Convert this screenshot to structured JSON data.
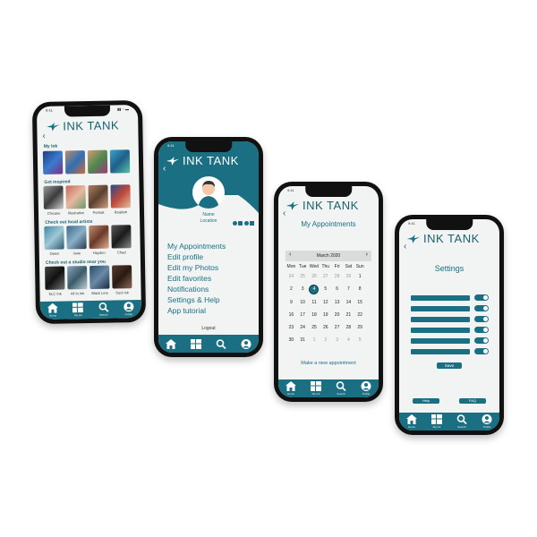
{
  "brand": {
    "name": "INK TANK",
    "accent": "#1a6f82"
  },
  "status": {
    "time": "9:41"
  },
  "home": {
    "sections": [
      {
        "title": "My Ink",
        "items": []
      },
      {
        "title": "Get inspired",
        "items": [
          "Chicano",
          "Illustrative",
          "Portrait",
          "Realism"
        ]
      },
      {
        "title": "Check out local artists",
        "items": [
          "Owen",
          "Jane",
          "Hayden",
          "Chad"
        ]
      },
      {
        "title": "Check out a studio near you",
        "items": [
          "SLC Ink",
          "All In Ink",
          "Black Line",
          "Soul Ink"
        ]
      }
    ]
  },
  "profile": {
    "name": "Name",
    "location": "Location",
    "social_icons": [
      "facebook-icon",
      "instagram-icon",
      "pinterest-icon",
      "twitter-icon"
    ],
    "menu": [
      "My Appointments",
      "Edit profile",
      "Edit my Photos",
      "Edit favorites",
      "Notifications",
      "Settings & Help",
      "App tutorial"
    ],
    "logout": "Logout"
  },
  "appointments": {
    "title": "My Appointments",
    "month": "March 2020",
    "weekdays": [
      "Mon",
      "Tue",
      "Wed",
      "Thu",
      "Fri",
      "Sat",
      "Sun"
    ],
    "days": [
      [
        "24",
        "25",
        "26",
        "27",
        "28",
        "29",
        "1"
      ],
      [
        "2",
        "3",
        "4",
        "5",
        "6",
        "7",
        "8"
      ],
      [
        "9",
        "10",
        "11",
        "12",
        "13",
        "14",
        "15"
      ],
      [
        "16",
        "17",
        "18",
        "19",
        "20",
        "21",
        "22"
      ],
      [
        "23",
        "24",
        "25",
        "26",
        "27",
        "28",
        "29"
      ],
      [
        "30",
        "31",
        "1",
        "2",
        "3",
        "4",
        "5"
      ]
    ],
    "selected_day": "4",
    "new_link": "Make a new appointment"
  },
  "settings": {
    "title": "Settings",
    "toggle_count": 6,
    "save": "Save",
    "help": "Help",
    "faq": "FAQ"
  },
  "tabs": [
    "Home",
    "My Ink",
    "Search",
    "Profile"
  ]
}
